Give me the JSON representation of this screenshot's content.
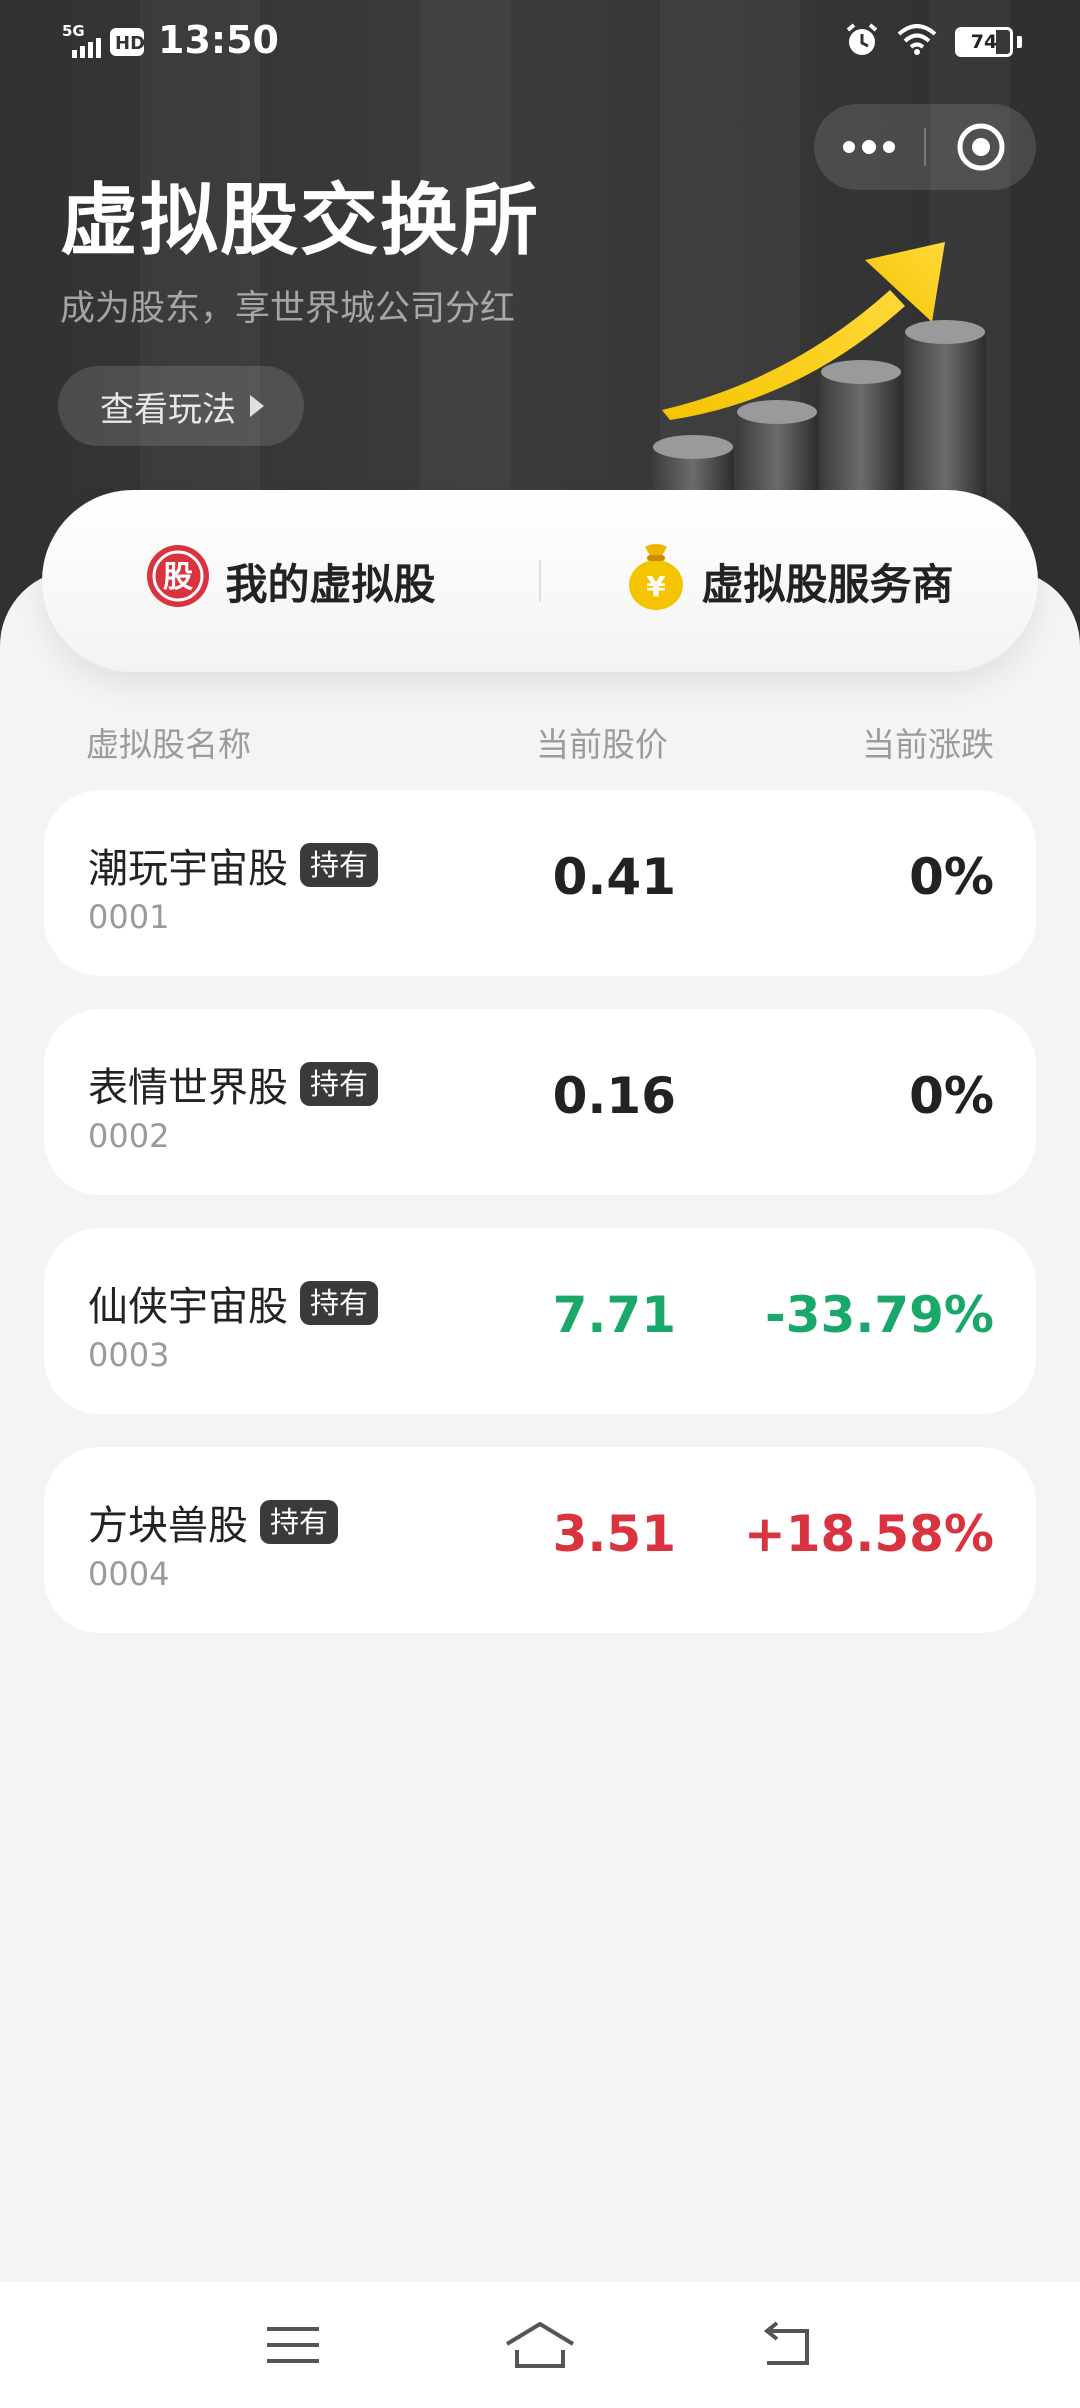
{
  "status_bar": {
    "network": "5G",
    "hd": "HD",
    "time": "13:50",
    "battery": "74",
    "battery_level": 0.74
  },
  "header": {
    "title": "虚拟股交换所",
    "subtitle": "成为股东，享世界城公司分红",
    "how_to_play": "查看玩法"
  },
  "tabs": [
    {
      "label": "我的虚拟股",
      "icon": "stock-badge-icon",
      "icon_char": "股"
    },
    {
      "label": "虚拟股服务商",
      "icon": "money-bag-icon",
      "icon_char": "¥"
    }
  ],
  "columns": {
    "name": "虚拟股名称",
    "price": "当前股价",
    "change": "当前涨跌"
  },
  "stocks": [
    {
      "name": "潮玩宇宙股",
      "badge": "持有",
      "code": "0001",
      "price": "0.41",
      "change": "0%",
      "trend": "flat"
    },
    {
      "name": "表情世界股",
      "badge": "持有",
      "code": "0002",
      "price": "0.16",
      "change": "0%",
      "trend": "flat"
    },
    {
      "name": "仙侠宇宙股",
      "badge": "持有",
      "code": "0003",
      "price": "7.71",
      "change": "-33.79%",
      "trend": "down"
    },
    {
      "name": "方块兽股",
      "badge": "持有",
      "code": "0004",
      "price": "3.51",
      "change": "+18.58%",
      "trend": "up"
    }
  ],
  "colors": {
    "flat": "#222222",
    "down": "#1aa86a",
    "up": "#d9333f",
    "header_bg": "#363535",
    "accent_gold": "#f5c400"
  },
  "navbar": {
    "menu": "menu-icon",
    "home": "home-icon",
    "back": "back-icon"
  }
}
